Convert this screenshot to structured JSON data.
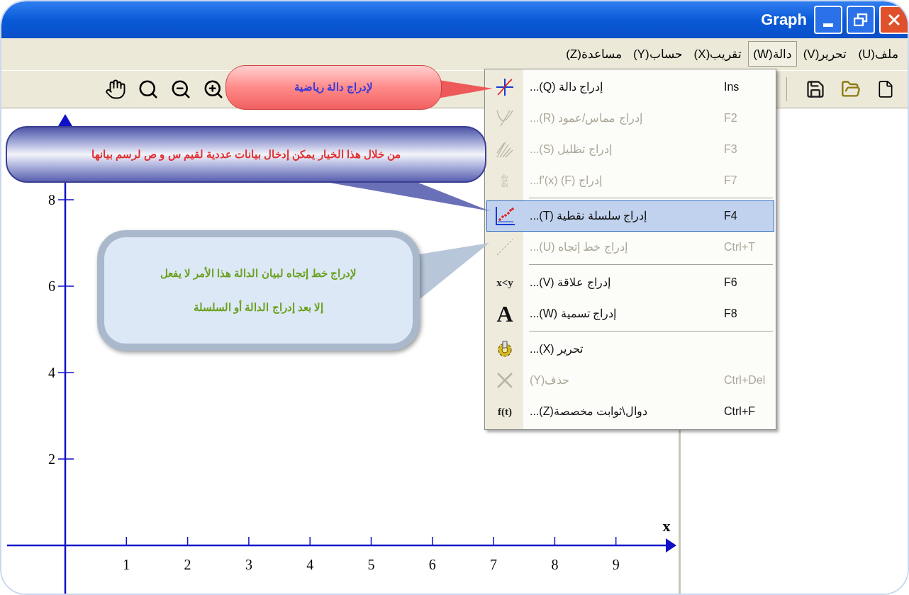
{
  "window": {
    "title": "Graph"
  },
  "menu_bar": [
    {
      "label": "ملف(U)",
      "selected": false
    },
    {
      "label": "تحرير(V)",
      "selected": false
    },
    {
      "label": "دالة(W)",
      "selected": true
    },
    {
      "label": "تقريب(X)",
      "selected": false
    },
    {
      "label": "حساب(Y)",
      "selected": false
    },
    {
      "label": "مساعدة(Z)",
      "selected": false
    }
  ],
  "dropdown": [
    {
      "kind": "function",
      "label": "إدراج دالة (Q)...",
      "shortcut": "Ins",
      "disabled": false,
      "selected": false
    },
    {
      "kind": "tangent",
      "label": "إدراج مماس/عمود (R)...",
      "shortcut": "F2",
      "disabled": true,
      "selected": false
    },
    {
      "kind": "shading",
      "label": "إدراج تظليل (S)...",
      "shortcut": "F3",
      "disabled": true,
      "selected": false
    },
    {
      "kind": "fraction",
      "icon_top": "dy",
      "icon_bottom": "dx",
      "label": "إدراج f'(x) (F)...",
      "shortcut": "F7",
      "disabled": true,
      "selected": false
    },
    {
      "kind": "separator"
    },
    {
      "kind": "points",
      "label": "إدراج سلسلة نقطية (T)...",
      "shortcut": "F4",
      "disabled": false,
      "selected": true
    },
    {
      "kind": "trend",
      "label": "إدراج خط إتجاه (U)...",
      "shortcut": "Ctrl+T",
      "disabled": true,
      "selected": false
    },
    {
      "kind": "separator"
    },
    {
      "kind": "glyph",
      "icon_text": "x<y",
      "label": "إدراج علاقة (V)...",
      "shortcut": "F6",
      "disabled": false,
      "selected": false
    },
    {
      "kind": "big_glyph",
      "icon_text": "A",
      "label": "إدراج تسمية (W)...",
      "shortcut": "F8",
      "disabled": false,
      "selected": false
    },
    {
      "kind": "separator"
    },
    {
      "kind": "gear",
      "label": "تحرير (X)...",
      "disabled": false,
      "selected": false
    },
    {
      "kind": "cross",
      "label": "حذف(Y)",
      "shortcut": "Ctrl+Del",
      "disabled": true,
      "selected": false
    },
    {
      "kind": "glyph",
      "icon_text": "f(t)",
      "label": "دوال\\ثوابت مخصصة(Z)...",
      "shortcut": "Ctrl+F",
      "disabled": false,
      "selected": false
    }
  ],
  "graph": {
    "x_label": "x",
    "x_ticks": [
      "9",
      "8",
      "7",
      "6",
      "5",
      "4",
      "3",
      "2",
      "1"
    ],
    "y_ticks": [
      "8",
      "6",
      "4",
      "2"
    ]
  },
  "callouts": [
    {
      "kind": "red",
      "text": [
        "لإدراج دالة رياضية"
      ]
    },
    {
      "kind": "purple",
      "text": [
        "من خلال هذا الخيار يمكن إدخال بيانات عددية لقيم س و ص لرسم بيانها"
      ]
    },
    {
      "kind": "light",
      "text": [
        "لإدراج خط إتجاه لبيان الدالة هذا الأمر لا يفعل",
        "إلا بعد إدراج الدالة أو السلسلة"
      ]
    }
  ]
}
